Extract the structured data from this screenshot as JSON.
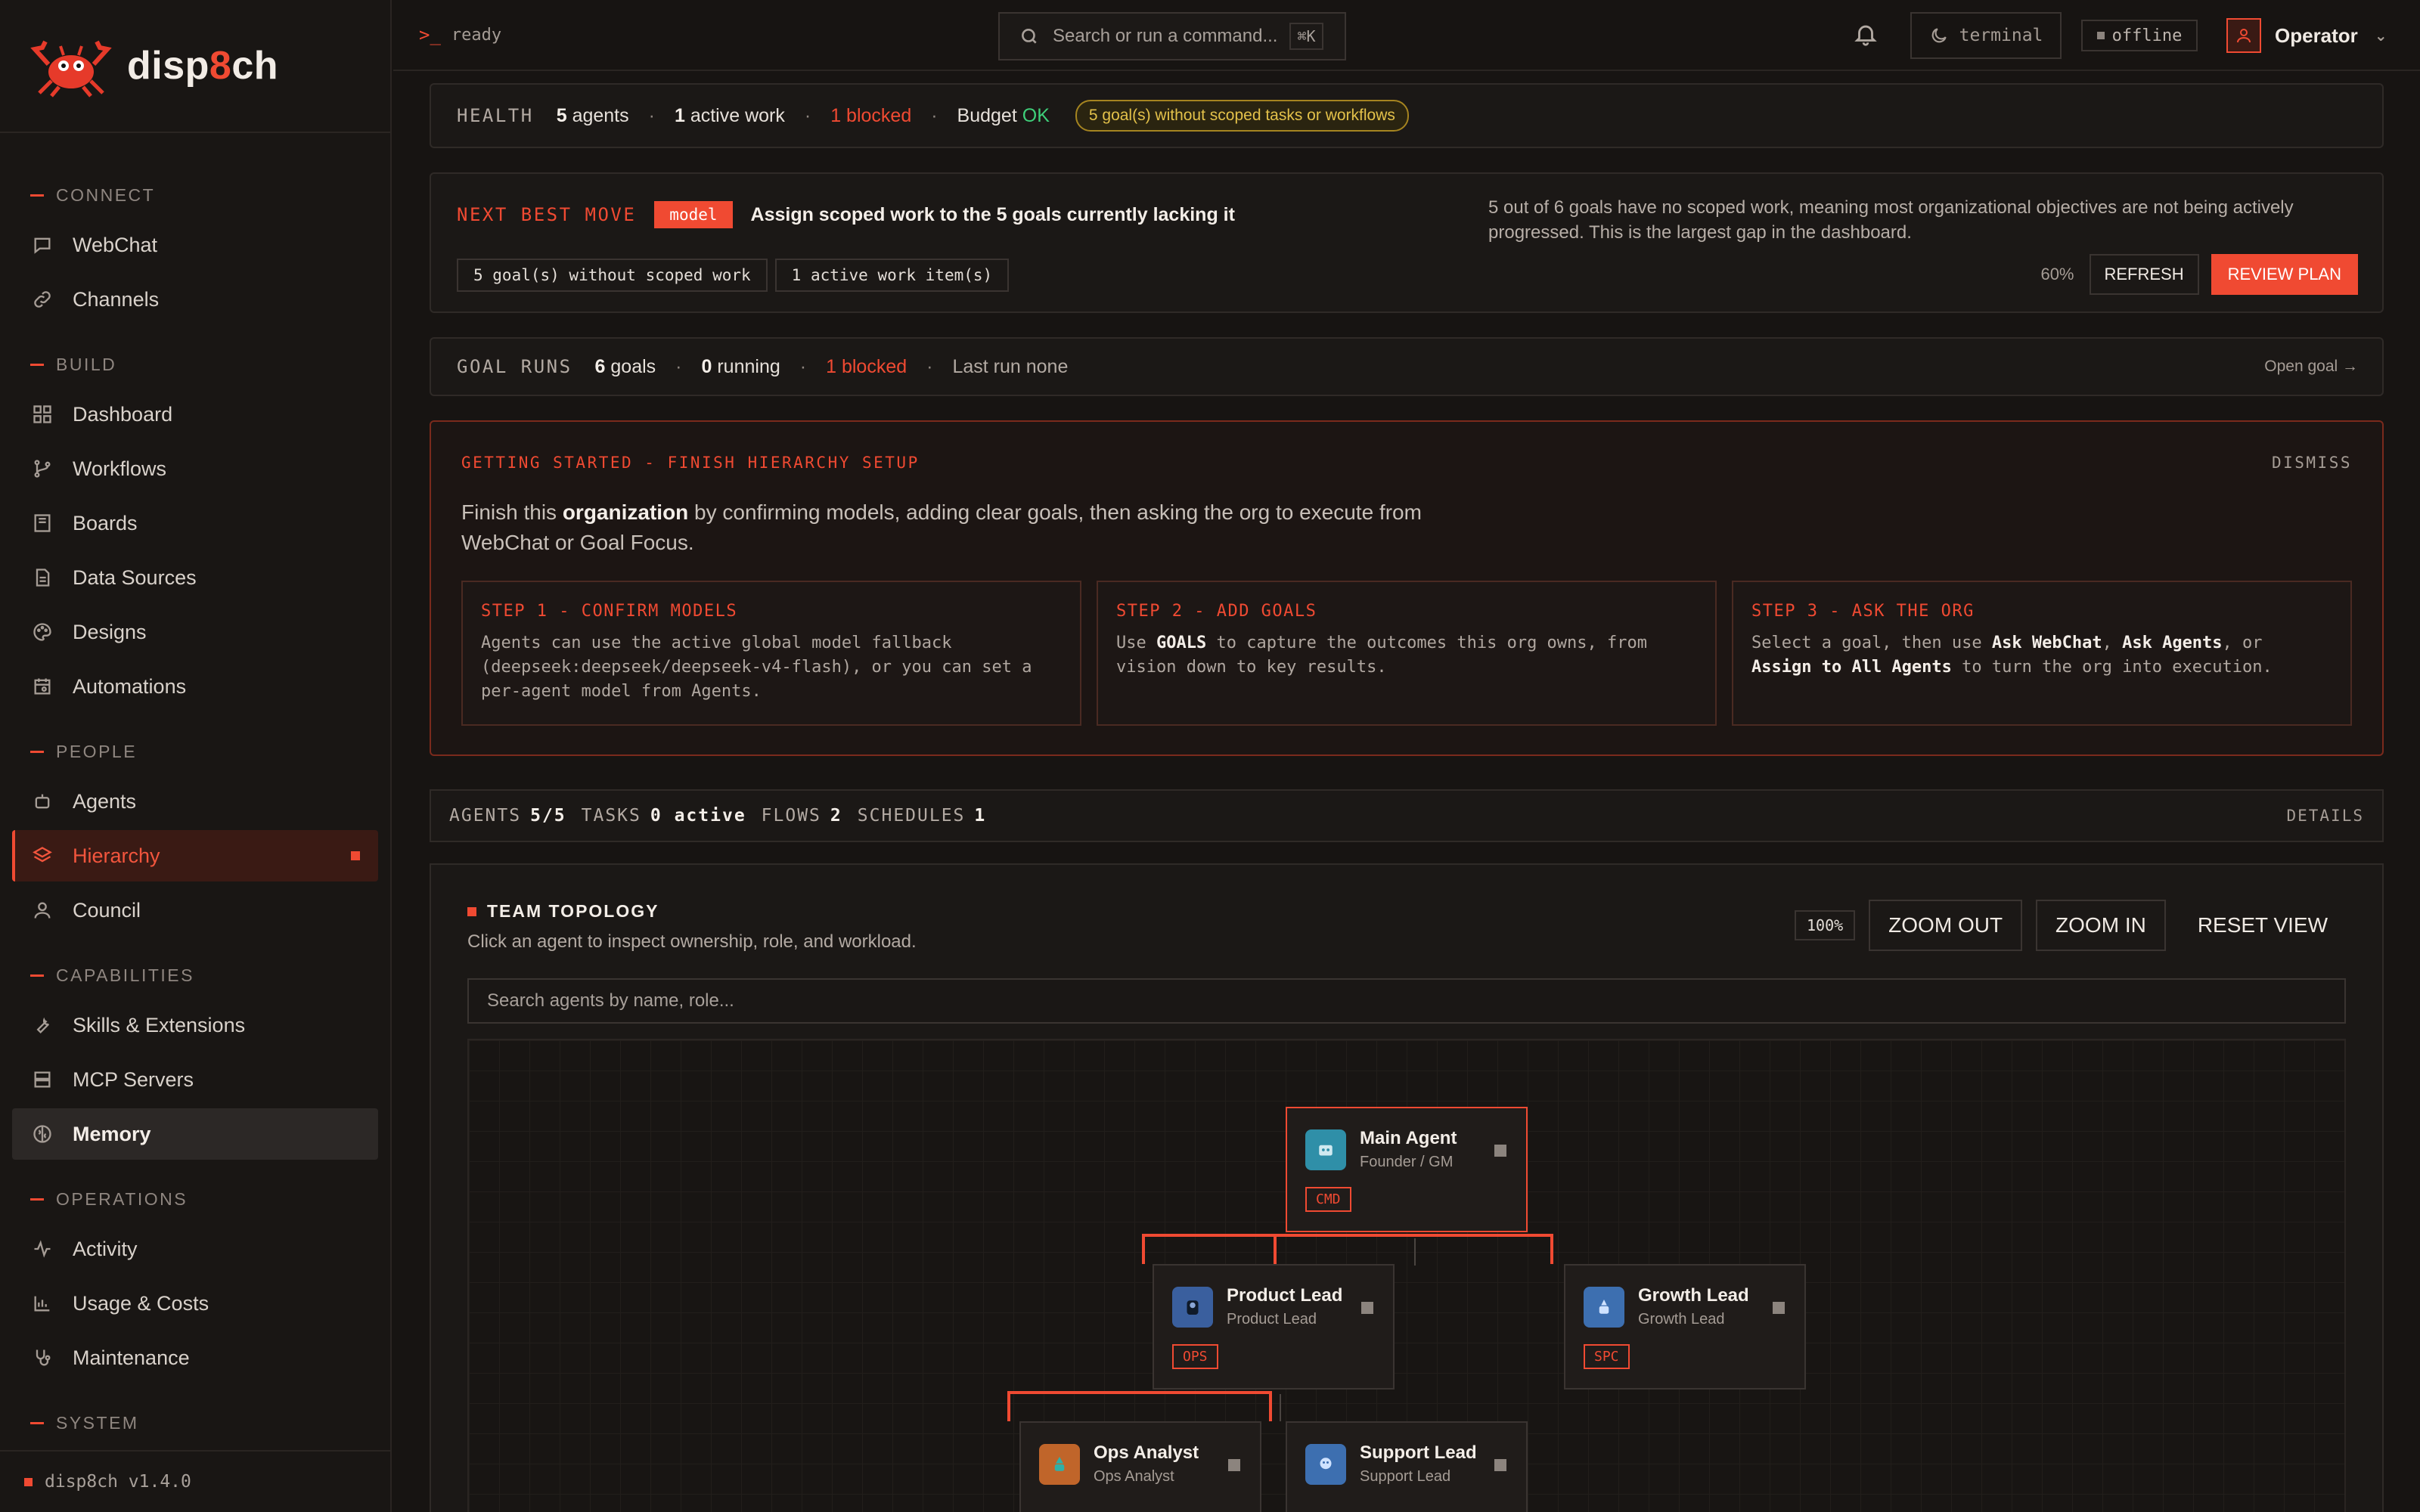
{
  "brand": {
    "name_prefix": "disp",
    "name_accent": "8",
    "name_suffix": "ch"
  },
  "sidebar": {
    "sections": [
      {
        "title": "CONNECT",
        "items": [
          {
            "label": "WebChat",
            "icon": "chat-icon"
          },
          {
            "label": "Channels",
            "icon": "link-icon"
          }
        ]
      },
      {
        "title": "BUILD",
        "items": [
          {
            "label": "Dashboard",
            "icon": "dashboard-icon"
          },
          {
            "label": "Workflows",
            "icon": "branch-icon"
          },
          {
            "label": "Boards",
            "icon": "board-icon"
          },
          {
            "label": "Data Sources",
            "icon": "document-icon"
          },
          {
            "label": "Designs",
            "icon": "palette-icon"
          },
          {
            "label": "Automations",
            "icon": "calendar-icon"
          }
        ]
      },
      {
        "title": "PEOPLE",
        "items": [
          {
            "label": "Agents",
            "icon": "robot-icon"
          },
          {
            "label": "Hierarchy",
            "icon": "layers-icon"
          },
          {
            "label": "Council",
            "icon": "user-icon"
          }
        ]
      },
      {
        "title": "CAPABILITIES",
        "items": [
          {
            "label": "Skills & Extensions",
            "icon": "wrench-icon"
          },
          {
            "label": "MCP Servers",
            "icon": "server-icon"
          },
          {
            "label": "Memory",
            "icon": "brain-icon"
          }
        ]
      },
      {
        "title": "OPERATIONS",
        "items": [
          {
            "label": "Activity",
            "icon": "activity-icon"
          },
          {
            "label": "Usage & Costs",
            "icon": "chart-icon"
          },
          {
            "label": "Maintenance",
            "icon": "stethoscope-icon"
          }
        ]
      },
      {
        "title": "SYSTEM"
      }
    ],
    "version": "disp8ch v1.4.0"
  },
  "topbar": {
    "status": "ready",
    "search_placeholder": "Search or run a command...",
    "shortcut": "⌘K",
    "theme_label": "terminal",
    "connection": "offline",
    "user": "Operator"
  },
  "health": {
    "label": "HEALTH",
    "agents_num": "5",
    "agents_txt": "agents",
    "work_num": "1",
    "work_txt": "active work",
    "blocked_num": "1",
    "blocked_txt": "blocked",
    "budget_txt": "Budget",
    "budget_status": "OK",
    "warning": "5 goal(s) without scoped tasks or workflows"
  },
  "next_best_move": {
    "label": "NEXT BEST MOVE",
    "tag": "model",
    "headline": "Assign scoped work to the 5 goals currently lacking it",
    "chips": [
      "5 goal(s) without scoped work",
      "1 active work item(s)"
    ],
    "description": "5 out of 6 goals have no scoped work, meaning most organizational objectives are not being actively progressed. This is the largest gap in the dashboard.",
    "confidence": "60%",
    "refresh": "REFRESH",
    "review": "REVIEW PLAN"
  },
  "goal_runs": {
    "label": "GOAL RUNS",
    "goals_num": "6",
    "goals_txt": "goals",
    "running_num": "0",
    "running_txt": "running",
    "blocked_num": "1",
    "blocked_txt": "blocked",
    "last_run": "Last run none",
    "open": "Open goal →"
  },
  "getting_started": {
    "label": "GETTING STARTED - FINISH HIERARCHY SETUP",
    "dismiss": "DISMISS",
    "intro_a": "Finish this ",
    "intro_b": "organization",
    "intro_c": " by confirming models, adding clear goals, then asking the org to execute from WebChat or Goal Focus.",
    "steps": [
      {
        "title": "STEP 1 - CONFIRM MODELS",
        "body": "Agents can use the active global model fallback (deepseek:deepseek/deepseek-v4-flash), or you can set a per-agent model from Agents."
      },
      {
        "title": "STEP 2 - ADD GOALS",
        "body_a": "Use ",
        "body_b": "GOALS",
        "body_c": " to capture the outcomes this org owns, from vision down to key results."
      },
      {
        "title": "STEP 3 - ASK THE ORG",
        "body_a": "Select a goal, then use ",
        "body_b": "Ask WebChat",
        "body_c": ", ",
        "body_d": "Ask Agents",
        "body_e": ", or ",
        "body_f": "Assign to All Agents",
        "body_g": " to turn the org into execution."
      }
    ]
  },
  "stats": {
    "agents_lbl": "AGENTS",
    "agents_val": "5/5",
    "tasks_lbl": "TASKS",
    "tasks_val": "0 active",
    "flows_lbl": "FLOWS",
    "flows_val": "2",
    "sched_lbl": "SCHEDULES",
    "sched_val": "1",
    "details": "DETAILS"
  },
  "topology": {
    "title": "TEAM TOPOLOGY",
    "subtitle": "Click an agent to inspect ownership, role, and workload.",
    "zoom": "100%",
    "zoom_out": "ZOOM OUT",
    "zoom_in": "ZOOM IN",
    "reset": "RESET VIEW",
    "search_placeholder": "Search agents by name, role...",
    "nodes": [
      {
        "name": "Main Agent",
        "role": "Founder / GM",
        "tag": "CMD",
        "color": "#2f8fa8"
      },
      {
        "name": "Product Lead",
        "role": "Product Lead",
        "tag": "OPS",
        "color": "#3a5f9e"
      },
      {
        "name": "Growth Lead",
        "role": "Growth Lead",
        "tag": "SPC",
        "color": "#3d6fb0"
      },
      {
        "name": "Ops Analyst",
        "role": "Ops Analyst",
        "tag": "",
        "color": "#c0652a"
      },
      {
        "name": "Support Lead",
        "role": "Support Lead",
        "tag": "",
        "color": "#3d6fb0"
      }
    ]
  }
}
